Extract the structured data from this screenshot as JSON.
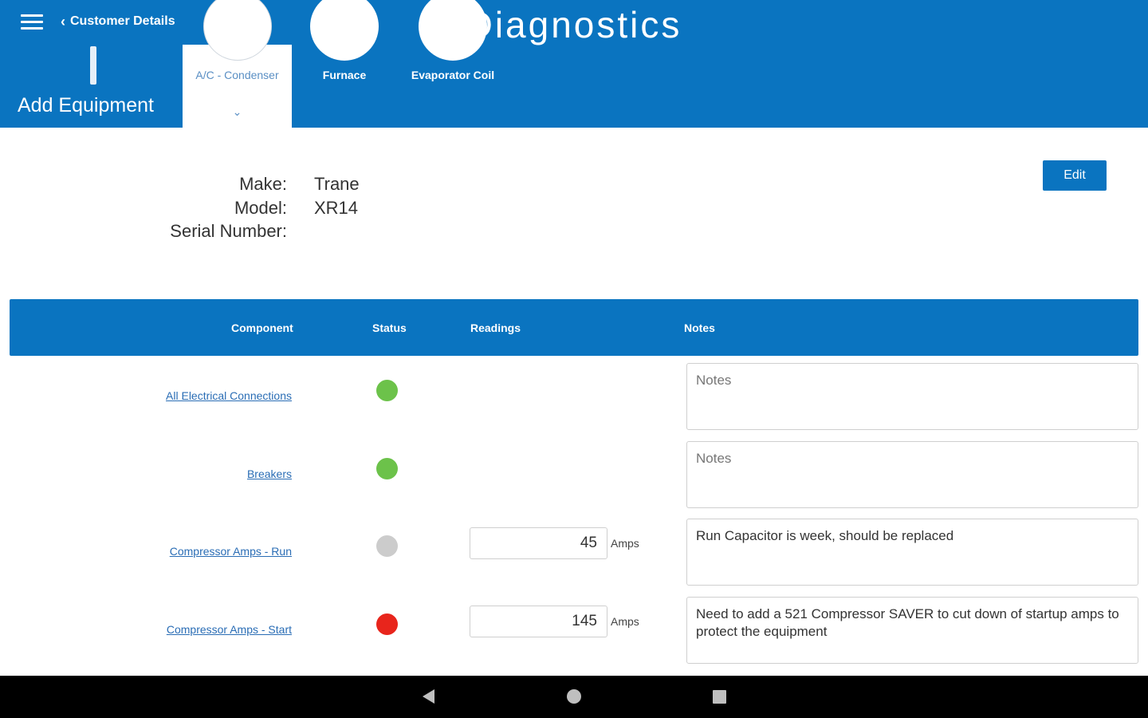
{
  "header": {
    "title": "Diagnostics",
    "back_label": "Customer Details",
    "add_equipment_label": "Add Equipment",
    "colors": {
      "primary": "#0a74c0",
      "link": "#2a6db5"
    }
  },
  "equipment_tabs": [
    {
      "label": "A/C - Condenser",
      "active": true
    },
    {
      "label": "Furnace",
      "active": false
    },
    {
      "label": "Evaporator Coil",
      "active": false
    }
  ],
  "equipment": {
    "make_label": "Make:",
    "make_value": "Trane",
    "model_label": "Model:",
    "model_value": "XR14",
    "serial_label": "Serial Number:",
    "serial_value": ""
  },
  "edit_label": "Edit",
  "table": {
    "headers": {
      "component": "Component",
      "status": "Status",
      "readings": "Readings",
      "notes": "Notes"
    },
    "rows": [
      {
        "component": "All Electrical Connections",
        "status": "green",
        "status_color": "#6cc24a",
        "reading": "",
        "unit": "",
        "notes": "",
        "notes_placeholder": "Notes"
      },
      {
        "component": "Breakers",
        "status": "green",
        "status_color": "#6cc24a",
        "reading": "",
        "unit": "",
        "notes": "",
        "notes_placeholder": "Notes"
      },
      {
        "component": "Compressor Amps - Run",
        "status": "gray",
        "status_color": "#cccccc",
        "reading": "45",
        "unit": "Amps",
        "notes": "Run Capacitor is week, should be replaced",
        "notes_placeholder": "Notes"
      },
      {
        "component": "Compressor Amps - Start",
        "status": "red",
        "status_color": "#e8251c",
        "reading": "145",
        "unit": "Amps",
        "notes": "Need to add a 521 Compressor SAVER to cut down of startup amps to protect the equipment",
        "notes_placeholder": "Notes"
      }
    ]
  }
}
